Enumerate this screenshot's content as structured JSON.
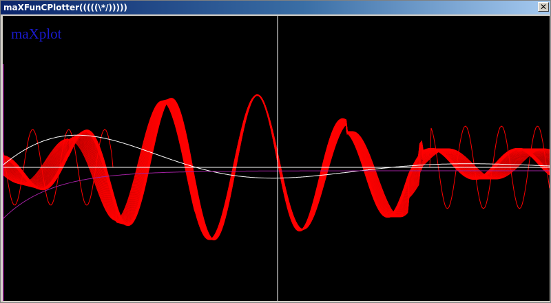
{
  "window": {
    "title": "maXFunCPlotter(((((\\*/)))))",
    "close_glyph": "✕"
  },
  "plot": {
    "label": "maXplot",
    "label_color": "#1a1ad0",
    "background": "#000000",
    "axis_color": "#ffffff",
    "curve_colors": {
      "red_band": "#ff0000",
      "white_curve": "#ffffff",
      "purple_curve": "#a020a0",
      "left_edge_line": "#ff33ff"
    }
  }
}
